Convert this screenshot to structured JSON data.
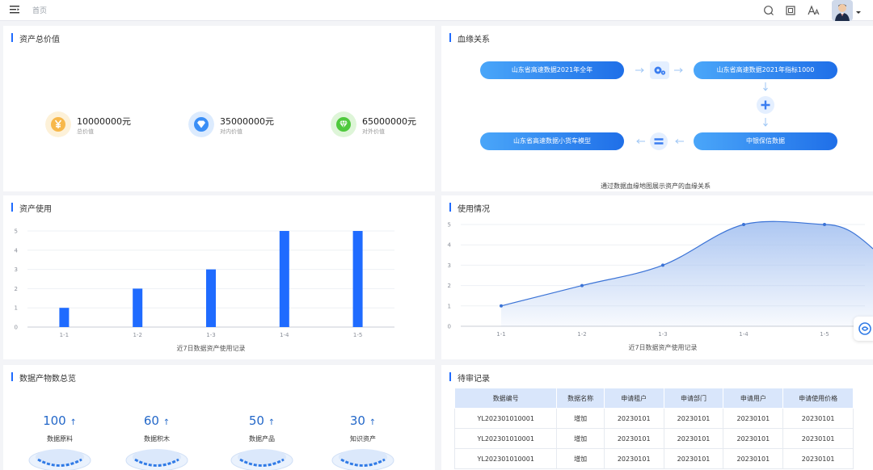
{
  "header": {
    "breadcrumb": "首页"
  },
  "asset_value": {
    "title": "资产总价值",
    "items": [
      {
        "value": "10000000元",
        "label": "总价值",
        "icon": "yen-icon",
        "color": "#f7b84b"
      },
      {
        "value": "35000000元",
        "label": "对内价值",
        "icon": "diamond-icon",
        "color": "#3a8ef6"
      },
      {
        "value": "65000000元",
        "label": "对外价值",
        "icon": "gem-icon",
        "color": "#4fc93d"
      }
    ]
  },
  "lineage": {
    "title": "血缘关系",
    "nodes": {
      "source": "山东省高速数据2021年全年",
      "target": "山东省高速数据2021年指标1000",
      "model": "山东省高速数据小货车模型",
      "medium": "中银保信数据"
    },
    "caption": "通过数据血缘地图展示资产的血缘关系"
  },
  "asset_usage": {
    "title": "资产使用",
    "chart_data": {
      "type": "bar",
      "categories": [
        "1-1",
        "1-2",
        "1-3",
        "1-4",
        "1-5"
      ],
      "values": [
        1,
        2,
        3,
        5,
        5
      ],
      "xlabel": "近7日数据资产使用记录",
      "ylabel": "",
      "ylim": [
        0,
        5
      ],
      "yticks": [
        0,
        1,
        2,
        3,
        4,
        5
      ],
      "color": "#1f6bff",
      "grid": true
    }
  },
  "usage_status": {
    "title": "使用情况",
    "chart_data": {
      "type": "area",
      "categories": [
        "1-1",
        "1-2",
        "1-3",
        "1-4",
        "1-5"
      ],
      "values": [
        1,
        2,
        3,
        5,
        5
      ],
      "xlabel": "近7日数据资产使用记录",
      "ylabel": "",
      "ylim": [
        0,
        5
      ],
      "yticks": [
        0,
        1,
        2,
        3,
        4,
        5
      ],
      "color": "#3b73d6",
      "fill": "#a9c4f1",
      "grid": true
    }
  },
  "product_overview": {
    "title": "数据产物数总览",
    "stats": [
      {
        "value": "100",
        "label": "数据原料"
      },
      {
        "value": "60",
        "label": "数据积木"
      },
      {
        "value": "50",
        "label": "数据产品"
      },
      {
        "value": "30",
        "label": "知识资产"
      }
    ]
  },
  "pending": {
    "title": "待审记录",
    "columns": [
      "数据编号",
      "数据名称",
      "申请租户",
      "申请部门",
      "申请用户",
      "申请使用价格"
    ],
    "rows": [
      [
        "YL202301010001",
        "增加",
        "20230101",
        "20230101",
        "20230101",
        "20230101"
      ],
      [
        "YL202301010001",
        "增加",
        "20230101",
        "20230101",
        "20230101",
        "20230101"
      ],
      [
        "YL202301010001",
        "增加",
        "20230101",
        "20230101",
        "20230101",
        "20230101"
      ]
    ]
  }
}
